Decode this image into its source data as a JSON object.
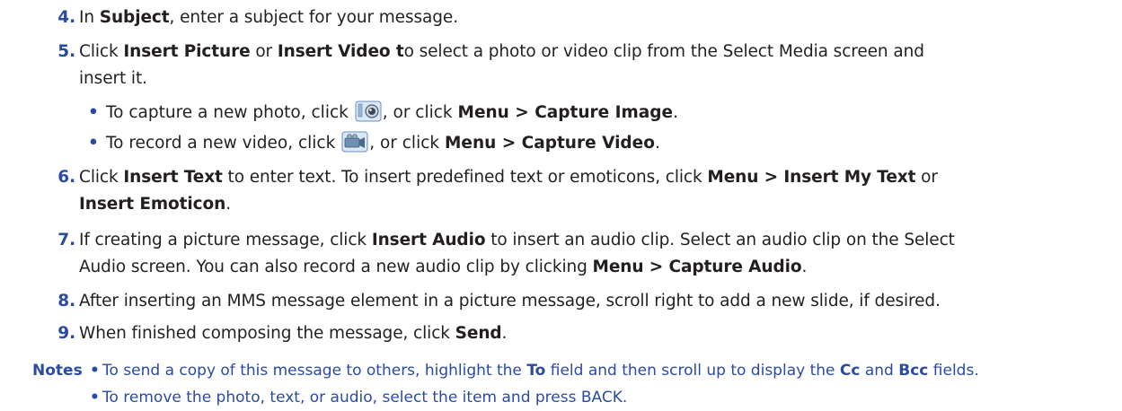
{
  "steps": [
    {
      "num": "4.",
      "p1": "In ",
      "b1": "Subject",
      "p2": ", enter a subject for your message."
    },
    {
      "num": "5.",
      "p1": "Click ",
      "b1": "Insert Picture",
      "p2": " or ",
      "b2": "Insert Video t",
      "p3": "o select a photo or video clip from the Select Media screen and",
      "line2": "insert it."
    },
    {
      "num": "6.",
      "p1": "Click ",
      "b1": "Insert Text",
      "p2": " to enter text. To insert predefined text or emoticons, click ",
      "b2": "Menu > Insert My Text",
      "p3": " or",
      "line2_bold": "Insert Emoticon",
      "line2_tail": "."
    },
    {
      "num": "7.",
      "p1": "If creating a picture message, click ",
      "b1": "Insert Audio",
      "p2": " to insert an audio clip. Select an audio clip on the Select",
      "line2": "Audio screen. You can also record a new audio clip by clicking ",
      "line2_bold": "Menu > Capture Audio",
      "line2_tail": "."
    },
    {
      "num": "8.",
      "p1": "After inserting an MMS message element in a picture message, scroll right to add a new slide, if desired."
    },
    {
      "num": "9.",
      "p1": "When finished composing the message, click ",
      "b1": "Send",
      "p2": "."
    }
  ],
  "bullets": [
    {
      "p1": "To capture a new photo, click ",
      "icon": "camera-icon",
      "p2": ", or click ",
      "b1": "Menu > Capture Image",
      "p3": "."
    },
    {
      "p1": "To record a new video, click ",
      "icon": "video-camera-icon",
      "p2": ", or click ",
      "b1": "Menu > Capture Video",
      "p3": "."
    }
  ],
  "notes": {
    "label": "Notes",
    "items": [
      {
        "p1": "To send a copy of this message to others, highlight the ",
        "b1": "To",
        "p2": " field and then scroll up to display the ",
        "b2": "Cc",
        "p3": " and ",
        "b3": "Bcc",
        "p4": " fields."
      },
      {
        "p1": "To remove the photo, text, or audio, select the item and press BACK."
      }
    ]
  },
  "colors": {
    "accent": "#2b4ba0",
    "text": "#231f20"
  }
}
